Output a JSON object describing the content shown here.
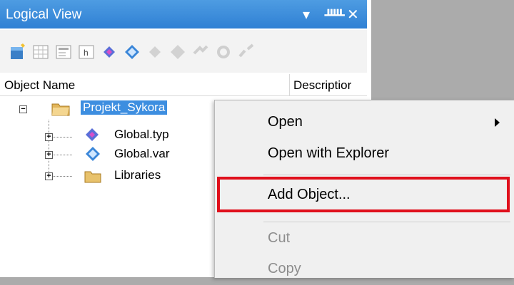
{
  "panel": {
    "title": "Logical View",
    "controls": {
      "dropdown": "▼",
      "pin": "ᚊ",
      "close": "✕"
    }
  },
  "toolbar": {
    "icons": [
      "new-object-icon",
      "table-icon",
      "form-icon",
      "header-file-icon",
      "type-file-icon",
      "variable-file-icon",
      "disabled-type-icon",
      "disabled-variable-icon",
      "disabled-link-icon",
      "disabled-refresh-icon",
      "disabled-unlink-icon"
    ]
  },
  "columns": {
    "object_name": "Object Name",
    "description": "Descriptior"
  },
  "tree": {
    "root": {
      "label": "Projekt_Sykora",
      "expander": "−"
    },
    "children": [
      {
        "label": "Global.typ",
        "expander": "+"
      },
      {
        "label": "Global.var",
        "expander": "+"
      },
      {
        "label": "Libraries",
        "expander": "+"
      }
    ]
  },
  "context_menu": {
    "items": [
      {
        "label": "Open"
      },
      {
        "label": "Open with Explorer"
      },
      {
        "label": "Add Object..."
      },
      {
        "label": "Cut"
      },
      {
        "label": "Copy"
      }
    ]
  },
  "colors": {
    "titlebar": "#2f80d4",
    "selection": "#3d8ee0",
    "highlight_box": "#e0101c",
    "background": "#ababab"
  }
}
